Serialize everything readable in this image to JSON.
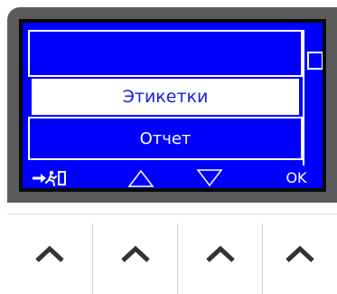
{
  "menu": {
    "items": [
      "",
      "Этикетки",
      "Отчет"
    ],
    "selected_index": 1
  },
  "softkeys": {
    "exit_icon": "exit-running-man-icon",
    "up_icon": "triangle-up-icon",
    "down_icon": "triangle-down-icon",
    "ok_label": "OK"
  },
  "hardware_buttons": [
    "chevron-up-icon",
    "chevron-up-icon",
    "chevron-up-icon",
    "chevron-up-icon"
  ],
  "colors": {
    "screen_background": "#0000ff",
    "selected_text": "#1a1aee",
    "bezel": "#5c5c5c",
    "chevron": "#333333"
  }
}
